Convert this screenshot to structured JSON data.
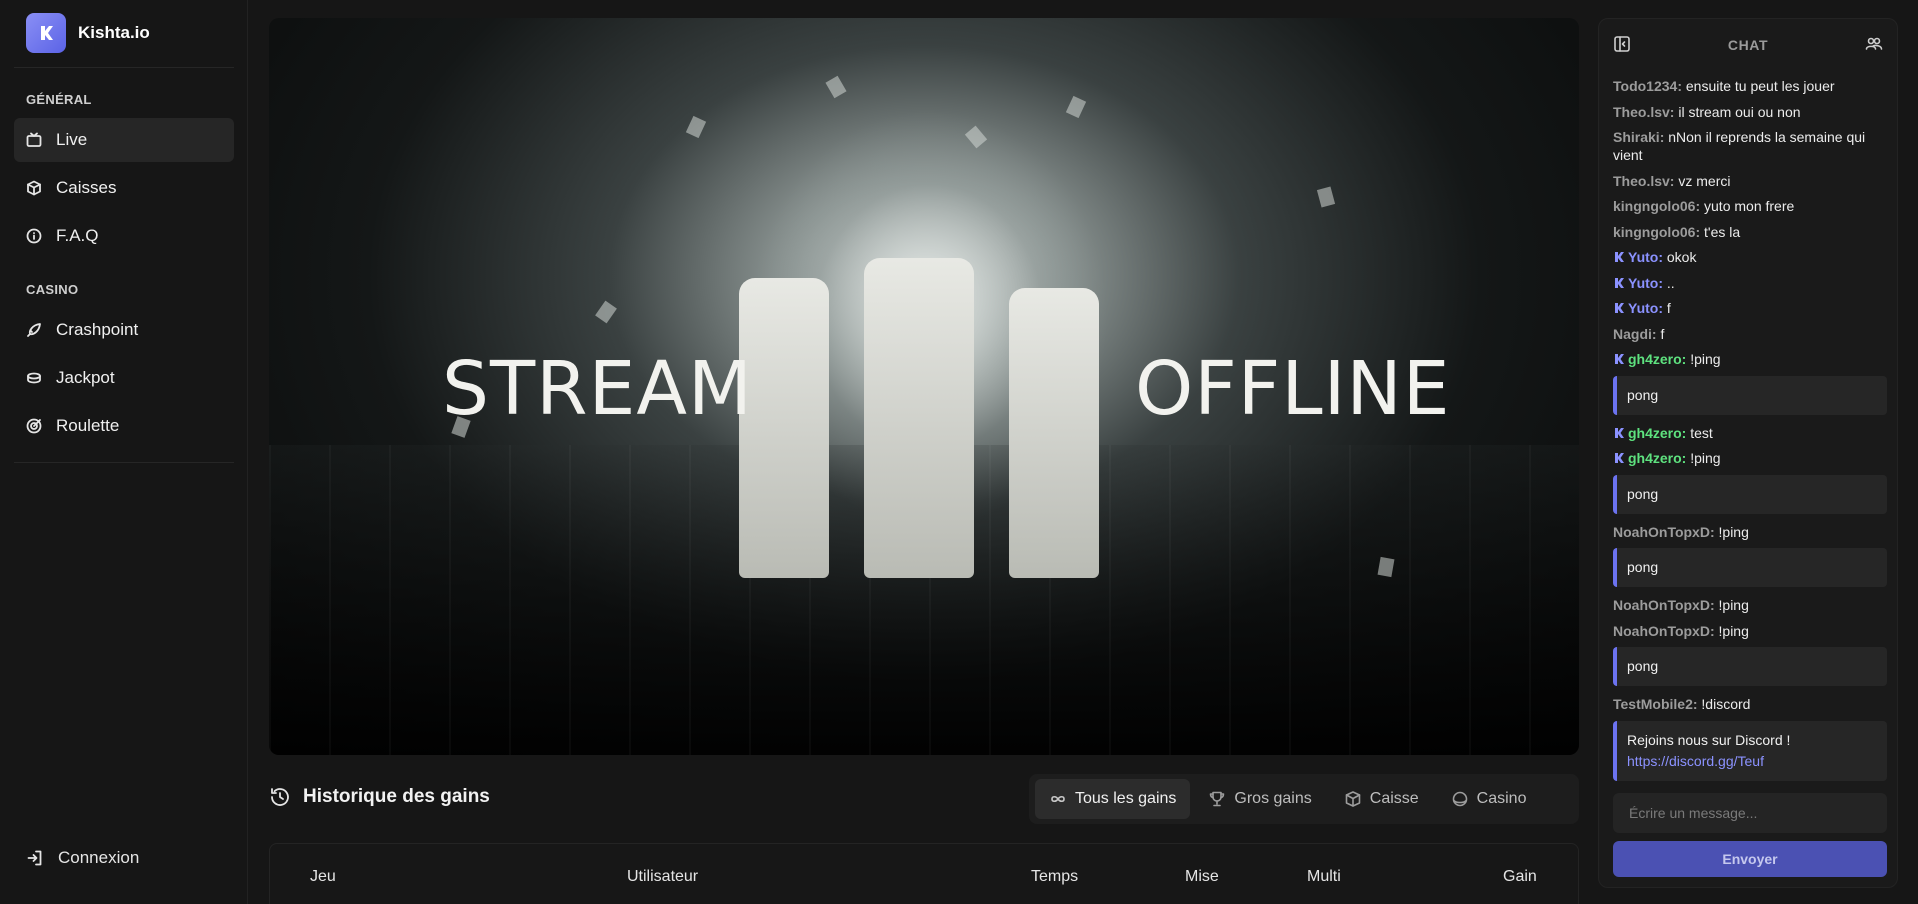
{
  "brand": {
    "name": "Kishta.io",
    "accent": "#6c73f0"
  },
  "sidebar": {
    "general_label": "GÉNÉRAL",
    "general_items": [
      {
        "label": "Live",
        "icon": "tv-icon",
        "active": true
      },
      {
        "label": "Caisses",
        "icon": "box-icon",
        "active": false
      },
      {
        "label": "F.A.Q",
        "icon": "info-icon",
        "active": false
      }
    ],
    "casino_label": "CASINO",
    "casino_items": [
      {
        "label": "Crashpoint",
        "icon": "rocket-icon"
      },
      {
        "label": "Jackpot",
        "icon": "coins-icon"
      },
      {
        "label": "Roulette",
        "icon": "target-icon"
      }
    ],
    "login_label": "Connexion"
  },
  "stream": {
    "word_left": "STREAM",
    "word_right": "OFFLINE"
  },
  "gains": {
    "title": "Historique des gains",
    "filters": [
      {
        "label": "Tous les gains",
        "icon": "infinity-icon",
        "active": true
      },
      {
        "label": "Gros gains",
        "icon": "trophy-icon",
        "active": false
      },
      {
        "label": "Caisse",
        "icon": "box-icon",
        "active": false
      },
      {
        "label": "Casino",
        "icon": "chip-icon",
        "active": false
      }
    ],
    "columns": [
      "Jeu",
      "Utilisateur",
      "Temps",
      "Mise",
      "Multi",
      "Gain"
    ]
  },
  "chat": {
    "title": "CHAT",
    "input_placeholder": "Écrire un message...",
    "send_label": "Envoyer",
    "messages": [
      {
        "type": "msg",
        "user": "Todo1234:",
        "text": "ensuite tu peut les jouer",
        "style": "normal"
      },
      {
        "type": "msg",
        "user": "Theo.lsv:",
        "text": "il stream oui ou non",
        "style": "normal"
      },
      {
        "type": "msg",
        "user": "Shiraki:",
        "text": "nNon il reprends la semaine qui vient",
        "style": "normal"
      },
      {
        "type": "msg",
        "user": "Theo.lsv:",
        "text": "vz merci",
        "style": "normal"
      },
      {
        "type": "msg",
        "user": "kingngolo06:",
        "text": "yuto mon frere",
        "style": "normal"
      },
      {
        "type": "msg",
        "user": "kingngolo06:",
        "text": "t'es la",
        "style": "normal"
      },
      {
        "type": "msg",
        "user": "Yuto:",
        "text": "okok",
        "style": "yuto"
      },
      {
        "type": "msg",
        "user": "Yuto:",
        "text": "..",
        "style": "yuto"
      },
      {
        "type": "msg",
        "user": "Yuto:",
        "text": "f",
        "style": "yuto"
      },
      {
        "type": "msg",
        "user": "Nagdi:",
        "text": "f",
        "style": "normal"
      },
      {
        "type": "msg",
        "user": "gh4zero:",
        "text": "!ping",
        "style": "gh"
      },
      {
        "type": "bot",
        "text": "pong"
      },
      {
        "type": "msg",
        "user": "gh4zero:",
        "text": "test",
        "style": "gh"
      },
      {
        "type": "msg",
        "user": "gh4zero:",
        "text": "!ping",
        "style": "gh"
      },
      {
        "type": "bot",
        "text": "pong"
      },
      {
        "type": "msg",
        "user": "NoahOnTopxD:",
        "text": "!ping",
        "style": "normal"
      },
      {
        "type": "bot",
        "text": "pong"
      },
      {
        "type": "msg",
        "user": "NoahOnTopxD:",
        "text": "!ping",
        "style": "normal"
      },
      {
        "type": "msg",
        "user": "NoahOnTopxD:",
        "text": "!ping",
        "style": "normal"
      },
      {
        "type": "bot",
        "text": "pong"
      },
      {
        "type": "msg",
        "user": "TestMobile2:",
        "text": "!discord",
        "style": "normal"
      },
      {
        "type": "bot",
        "text": "Rejoins nous sur Discord !",
        "link": "https://discord.gg/Teuf"
      }
    ]
  }
}
